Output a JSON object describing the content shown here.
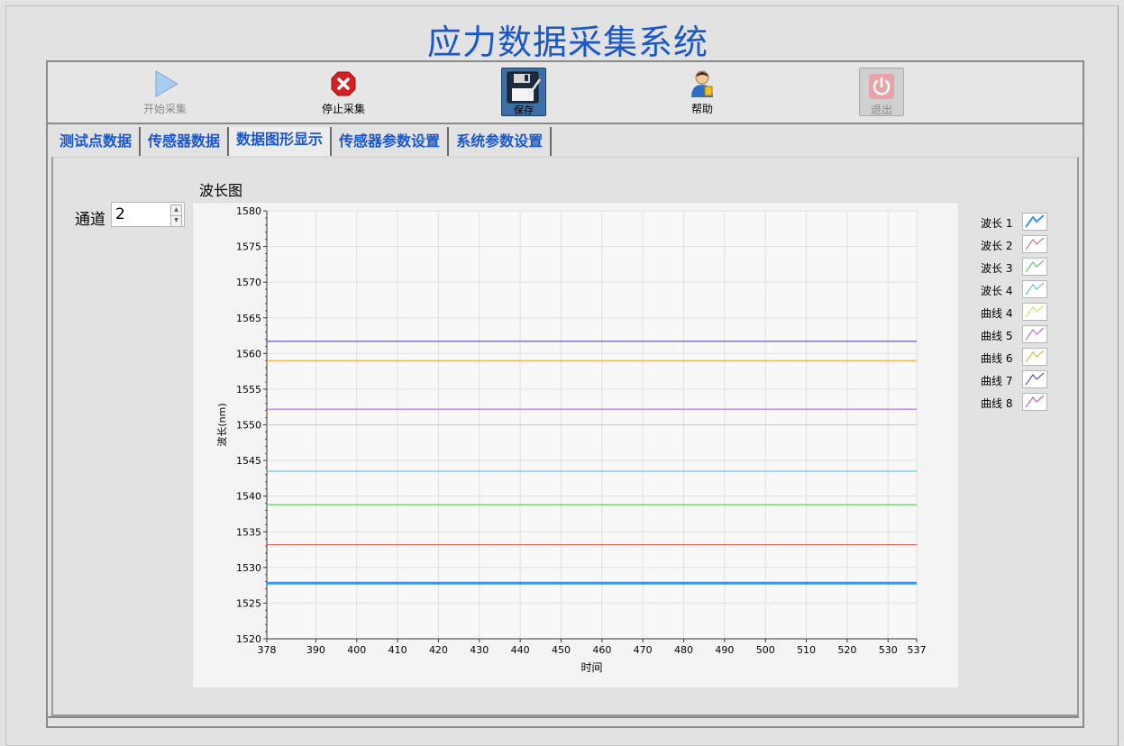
{
  "app": {
    "title": "应力数据采集系统"
  },
  "toolbar": {
    "start_label": "开始采集",
    "stop_label": "停止采集",
    "save_label": "保存",
    "help_label": "帮助",
    "exit_label": "退出"
  },
  "tabs": [
    {
      "label": "测试点数据",
      "active": false
    },
    {
      "label": "传感器数据",
      "active": false
    },
    {
      "label": "数据图形显示",
      "active": true
    },
    {
      "label": "传感器参数设置",
      "active": false
    },
    {
      "label": "系统参数设置",
      "active": false
    }
  ],
  "channel": {
    "label": "通道",
    "value": "2"
  },
  "graph": {
    "title": "波长图"
  },
  "chart_data": {
    "type": "line",
    "xlabel": "时间",
    "ylabel": "波长(nm)",
    "xlim": [
      378,
      537
    ],
    "ylim": [
      1520,
      1580
    ],
    "x_ticks": [
      378,
      390,
      400,
      410,
      420,
      430,
      440,
      450,
      460,
      470,
      480,
      490,
      500,
      510,
      520,
      530,
      537
    ],
    "y_ticks": [
      1520,
      1525,
      1530,
      1535,
      1540,
      1545,
      1550,
      1555,
      1560,
      1565,
      1570,
      1575,
      1580
    ],
    "grid": true,
    "legend_position": "right",
    "series": [
      {
        "name": "波长 1",
        "color": "#3b96e8",
        "values": [
          1527.8,
          1527.8
        ]
      },
      {
        "name": "波长 2",
        "color": "#e05a5a",
        "values": [
          1533.2,
          1533.2
        ]
      },
      {
        "name": "波长 3",
        "color": "#3cc43c",
        "values": [
          1538.8,
          1538.8
        ]
      },
      {
        "name": "波长 4",
        "color": "#4ab4e6",
        "values": [
          1543.5,
          1543.5
        ]
      },
      {
        "name": "曲线 4",
        "color": "#c8e04a",
        "values": [
          1550.0,
          1550.0
        ]
      },
      {
        "name": "曲线 5",
        "color": "#b055e0",
        "values": [
          1552.2,
          1552.2
        ]
      },
      {
        "name": "曲线 6",
        "color": "#f0a020",
        "values": [
          1559.0,
          1559.0
        ]
      },
      {
        "name": "曲线 7",
        "color": "#3a3aa8",
        "values": [
          1561.7,
          1561.7
        ]
      },
      {
        "name": "曲线 8",
        "color": "#c040c0",
        "values": []
      }
    ]
  }
}
